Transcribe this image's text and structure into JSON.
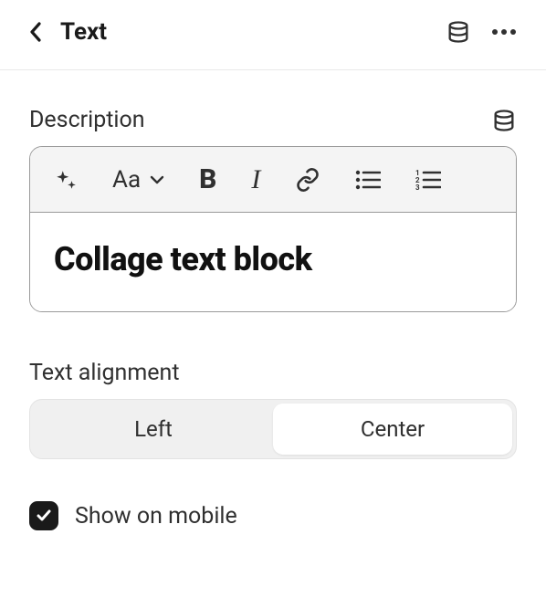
{
  "header": {
    "title": "Text"
  },
  "description": {
    "label": "Description",
    "content": "Collage text block"
  },
  "text_alignment": {
    "label": "Text alignment",
    "options": [
      "Left",
      "Center"
    ],
    "selected": "Center"
  },
  "show_on_mobile": {
    "label": "Show on mobile",
    "checked": true
  }
}
